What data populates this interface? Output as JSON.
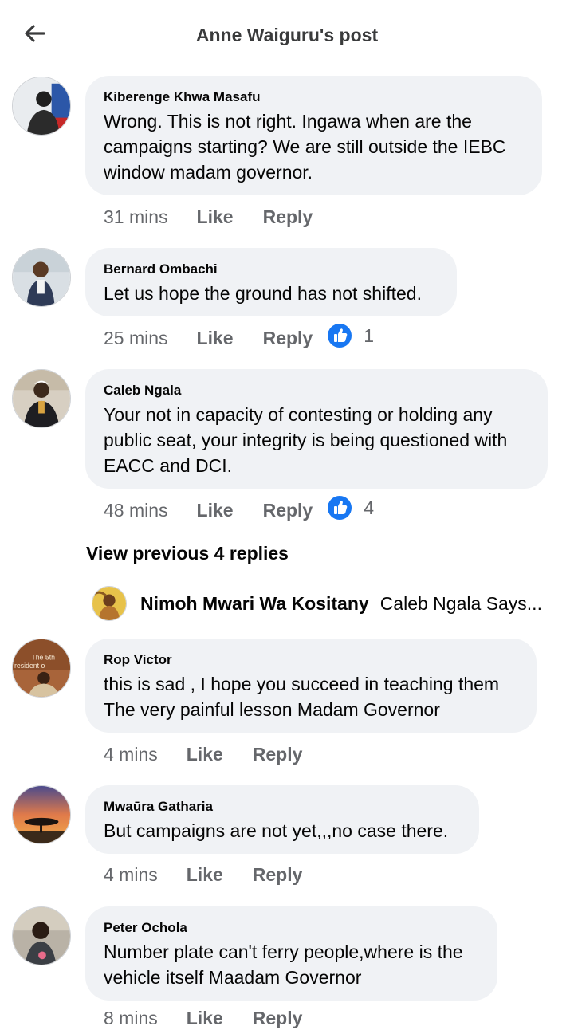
{
  "header": {
    "title": "Anne Waiguru's post",
    "back_icon": "arrow-left-icon"
  },
  "comments": [
    {
      "author": "Kiberenge Khwa Masafu",
      "lines": [
        "Wrong. This is not right. Ingawa when are the",
        "campaigns starting? We are still outside the IEBC",
        "window madam governor."
      ],
      "time": "31 mins",
      "like": "Like",
      "reply": "Reply"
    },
    {
      "author": "Bernard Ombachi",
      "lines": [
        "Let us hope the ground has not shifted."
      ],
      "time": "25 mins",
      "like": "Like",
      "reply": "Reply",
      "reaction_count": "1"
    },
    {
      "author": "Caleb Ngala",
      "lines": [
        "Your not in capacity of contesting or holding any",
        "public seat, your integrity is being questioned with",
        "EACC and DCI."
      ],
      "time": "48 mins",
      "like": "Like",
      "reply": "Reply",
      "reaction_count": "4"
    },
    {
      "author": "Rop Victor",
      "lines": [
        "this is sad , I hope you succeed in teaching them",
        "The very painful lesson Madam Governor"
      ],
      "time": "4 mins",
      "like": "Like",
      "reply": "Reply",
      "avatar_text": [
        "The 5th",
        "resident o"
      ]
    },
    {
      "author": "Mwaūra Gatharia",
      "lines": [
        "But campaigns are not yet,,,no case there."
      ],
      "time": "4 mins",
      "like": "Like",
      "reply": "Reply"
    },
    {
      "author": "Peter Ochola",
      "lines": [
        "Number plate can't ferry people,where is the",
        "vehicle itself Maadam Governor"
      ],
      "time": "8 mins",
      "like": "Like",
      "reply": "Reply"
    }
  ],
  "view_previous": "View previous 4 replies",
  "nested_reply": {
    "author": "Nimoh Mwari Wa Kositany",
    "preview": "Caleb Ngala Says..."
  },
  "colors": {
    "bubble": "#f0f2f5",
    "meta": "#65676b",
    "like_reaction": "#1877f2",
    "divider": "#dadde1"
  }
}
